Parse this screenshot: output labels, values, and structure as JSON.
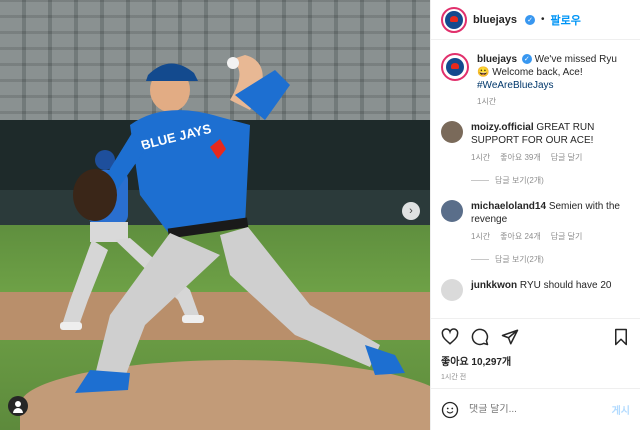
{
  "header": {
    "username": "bluejays",
    "dot": "•",
    "follow_label": "팔로우"
  },
  "caption": {
    "username": "bluejays",
    "text": "We've missed Ryu 😀 Welcome back, Ace!",
    "hashtag": "#WeAreBlueJays",
    "time": "1시간"
  },
  "comments": [
    {
      "username": "moizy.official",
      "text": "GREAT RUN SUPPORT FOR OUR ACE!",
      "time": "1시간",
      "likes": "좋아요 39개",
      "reply": "답글 달기",
      "view_replies": "답글 보기(2개)"
    },
    {
      "username": "michaeloland14",
      "text": "Semien with the revenge",
      "time": "1시간",
      "likes": "좋아요 24개",
      "reply": "답글 달기",
      "view_replies": "답글 보기(2개)"
    },
    {
      "username": "junkkwon",
      "text": "RYU should have 20"
    }
  ],
  "actions": {
    "likes_count": "좋아요 10,297개",
    "post_time": "1시간 전"
  },
  "add_comment": {
    "placeholder": "댓글 달기...",
    "post_label": "게시"
  },
  "photo": {
    "jersey_text": "BLUE JAYS"
  },
  "colors": {
    "accent": "#0095f6",
    "jersey": "#1d6fd1",
    "verified": "#3897f0"
  },
  "icons": [
    "heart-icon",
    "comment-icon",
    "share-icon",
    "bookmark-icon",
    "emoji-icon",
    "chevron-right-icon",
    "user-tag-icon"
  ]
}
